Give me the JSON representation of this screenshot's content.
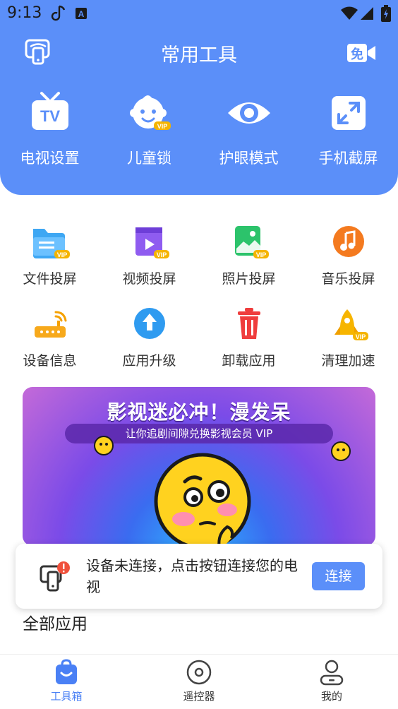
{
  "status": {
    "time": "9:13"
  },
  "header": {
    "title": "常用工具",
    "free_badge": "免"
  },
  "top_tools": [
    {
      "label": "电视设置",
      "icon": "tv-icon",
      "badge": ""
    },
    {
      "label": "儿童锁",
      "icon": "child-lock-icon",
      "badge": "VIP"
    },
    {
      "label": "护眼模式",
      "icon": "eye-icon",
      "badge": ""
    },
    {
      "label": "手机截屏",
      "icon": "screenshot-icon",
      "badge": ""
    }
  ],
  "tools": [
    {
      "label": "文件投屏",
      "icon": "folder-icon",
      "badge": "VIP"
    },
    {
      "label": "视频投屏",
      "icon": "video-icon",
      "badge": "VIP"
    },
    {
      "label": "照片投屏",
      "icon": "photo-icon",
      "badge": "VIP"
    },
    {
      "label": "音乐投屏",
      "icon": "music-icon",
      "badge": ""
    },
    {
      "label": "设备信息",
      "icon": "router-icon",
      "badge": ""
    },
    {
      "label": "应用升级",
      "icon": "upgrade-icon",
      "badge": ""
    },
    {
      "label": "卸载应用",
      "icon": "trash-icon",
      "badge": ""
    },
    {
      "label": "清理加速",
      "icon": "rocket-icon",
      "badge": "VIP"
    }
  ],
  "banner": {
    "title": "影视迷必冲！漫发呆",
    "subtitle": "让你追剧间隙兑换影视会员 VIP"
  },
  "toast": {
    "message": "设备未连接，点击按钮连接您的电视",
    "button": "连接"
  },
  "section_title": "全部应用",
  "bottom_nav": [
    {
      "label": "工具箱",
      "icon": "toolbox-icon",
      "active": true
    },
    {
      "label": "遥控器",
      "icon": "remote-icon",
      "active": false
    },
    {
      "label": "我的",
      "icon": "profile-icon",
      "active": false
    }
  ],
  "colors": {
    "accent": "#5b8ff9",
    "vip": "#f5b400"
  }
}
